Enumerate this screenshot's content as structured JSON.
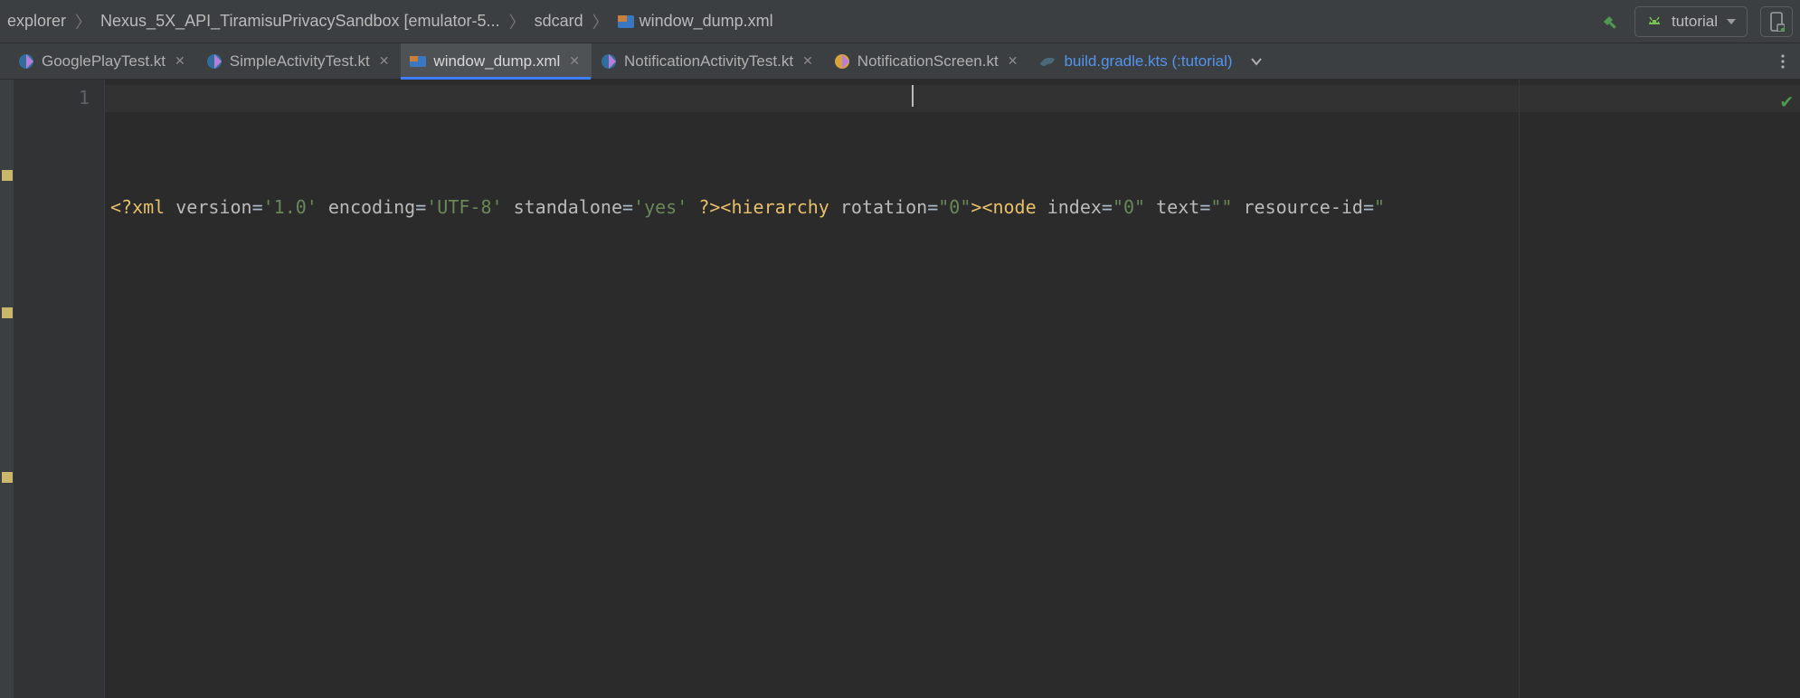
{
  "breadcrumb": {
    "items": [
      {
        "label": "explorer"
      },
      {
        "label": "Nexus_5X_API_TiramisuPrivacySandbox [emulator-5..."
      },
      {
        "label": "sdcard"
      },
      {
        "label": "window_dump.xml",
        "icon": "xml"
      }
    ]
  },
  "toolbar": {
    "build_icon": "build-hammer-icon",
    "run_config": {
      "icon": "android-icon",
      "label": "tutorial"
    },
    "device_button_icon": "device-phone-icon"
  },
  "tabs": [
    {
      "label": "GooglePlayTest.kt",
      "icon": "kotlin",
      "active": false,
      "modified": false
    },
    {
      "label": "SimpleActivityTest.kt",
      "icon": "kotlin",
      "active": false,
      "modified": false
    },
    {
      "label": "window_dump.xml",
      "icon": "xml",
      "active": true,
      "modified": false
    },
    {
      "label": "NotificationActivityTest.kt",
      "icon": "kotlin",
      "active": false,
      "modified": false
    },
    {
      "label": "NotificationScreen.kt",
      "icon": "kotlin",
      "active": false,
      "modified": false
    },
    {
      "label": "build.gradle.kts (:tutorial)",
      "icon": "gradle",
      "active": false,
      "modified": true
    }
  ],
  "editor": {
    "line_number": "1",
    "code_tokens": {
      "pi_open": "<?",
      "pi_name": "xml",
      "attr_version": "version",
      "val_version": "'1.0'",
      "attr_encoding": "encoding",
      "val_encoding": "'UTF-8'",
      "attr_standalone": "standalone",
      "val_standalone": "'yes'",
      "pi_close": "?>",
      "tag_hierarchy_open": "<hierarchy",
      "attr_rotation": "rotation",
      "val_rotation": "\"0\"",
      "gt": ">",
      "tag_node_open": "<node",
      "attr_index": "index",
      "val_index": "\"0\"",
      "attr_text": "text",
      "val_text": "\"\"",
      "attr_resid": "resource-id",
      "eq": "=",
      "trailing_quote": "\""
    },
    "status_indicator": "ok"
  }
}
